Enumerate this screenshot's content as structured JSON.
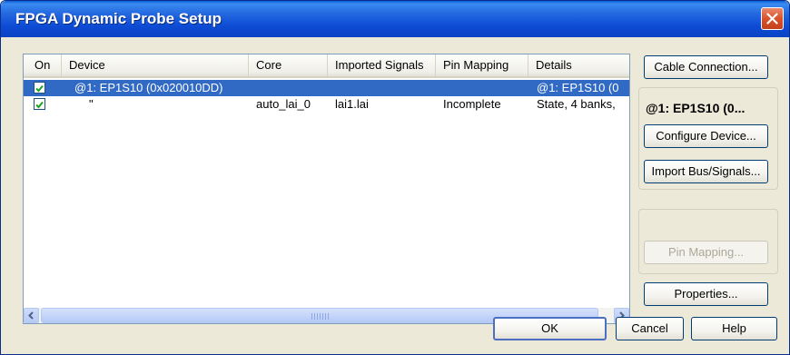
{
  "window": {
    "title": "FPGA Dynamic Probe Setup"
  },
  "table": {
    "columns": [
      "On",
      "Device",
      "Core",
      "Imported Signals",
      "Pin Mapping",
      "Details"
    ],
    "rows": [
      {
        "on": true,
        "device": "@1: EP1S10 (0x020010DD)",
        "core": "",
        "imported_signals": "",
        "pin_mapping": "",
        "details": "@1: EP1S10 (0",
        "selected": true
      },
      {
        "on": true,
        "device": "\"",
        "core": "auto_lai_0",
        "imported_signals": "lai1.lai",
        "pin_mapping": "Incomplete",
        "details": "State, 4 banks,",
        "selected": false
      }
    ]
  },
  "side": {
    "cable_connection": "Cable Connection...",
    "device_label": "@1: EP1S10 (0...",
    "configure_device": "Configure Device...",
    "import_bus_signals": "Import Bus/Signals...",
    "pin_mapping": "Pin Mapping...",
    "properties": "Properties..."
  },
  "footer": {
    "ok": "OK",
    "cancel": "Cancel",
    "help": "Help"
  },
  "colors": {
    "title_bar": "#0d4bd4",
    "selection": "#316ac5",
    "dialog_bg": "#ece9d8"
  }
}
